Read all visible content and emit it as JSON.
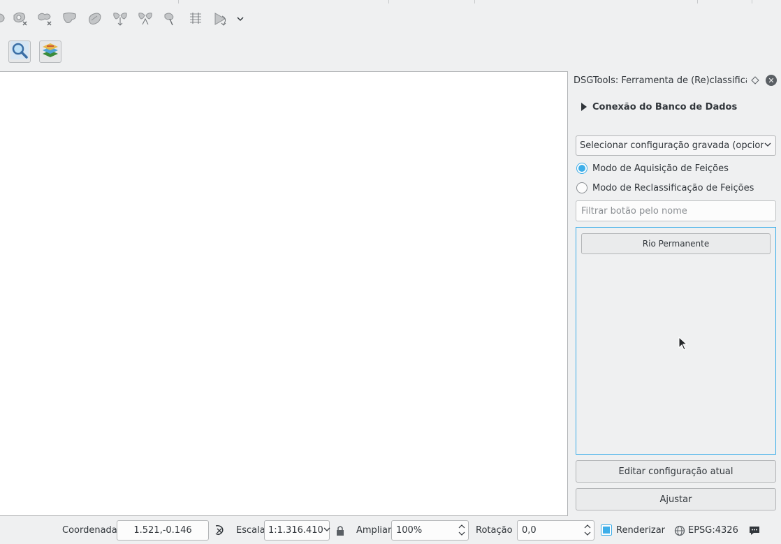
{
  "dock": {
    "title": "DSGTools: Ferramenta de (Re)classificaç...",
    "connection_section": "Conexão do Banco de Dados",
    "config_combo": "Selecionar configuração gravada (opcional)",
    "modes": [
      {
        "label": "Modo de Aquisição de Feições",
        "checked": true
      },
      {
        "label": "Modo de Reclassificação de Feições",
        "checked": false
      }
    ],
    "filter_placeholder": "Filtrar botão pelo nome",
    "class_buttons": [
      "Rio Permanente"
    ],
    "edit_button": "Editar configuração atual",
    "adjust_button": "Ajustar"
  },
  "status_bar": {
    "coordinate_label": "Coordenada",
    "coordinate_value": "1.521,-0.146",
    "scale_label": "Escala",
    "scale_value": "1:1.316.410",
    "magnify_label": "Ampliar",
    "magnify_value": "100%",
    "rotation_label": "Rotação",
    "rotation_value": "0,0",
    "render_label": "Renderizar",
    "render_checked": true,
    "crs": "EPSG:4326"
  },
  "colors": {
    "accent": "#3daee9",
    "background": "#eff0f1",
    "canvas": "#ffffff"
  },
  "toolbar": {
    "icons": [
      "reshape-feature-icon",
      "delete-ring-icon",
      "delete-part-icon",
      "fill-ring-icon",
      "merge-features-icon",
      "split-features-icon",
      "split-parts-icon",
      "rotate-point-symbols-icon",
      "offset-curve-icon",
      "node-tool-icon",
      "more-tools-icon"
    ],
    "big_buttons": [
      "zoom-tool-icon",
      "layers-styling-icon"
    ]
  }
}
